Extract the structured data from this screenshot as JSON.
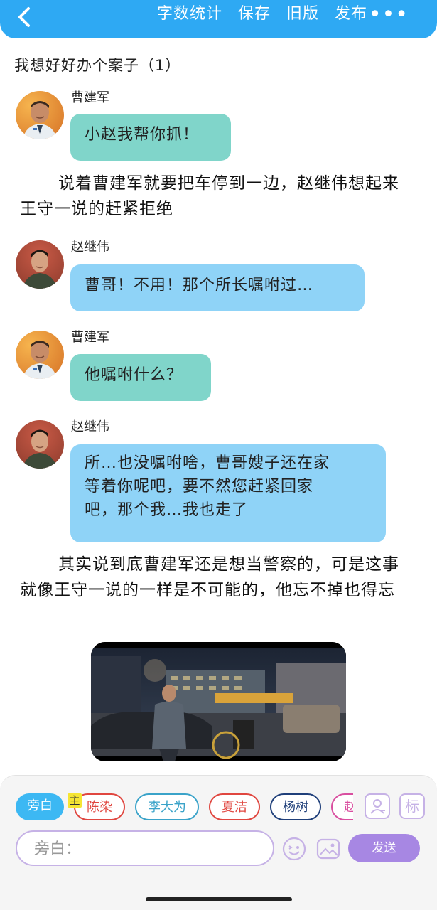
{
  "header": {
    "back_icon": "chevron-left-icon",
    "actions": [
      "字数统计",
      "保存",
      "旧版",
      "发布"
    ],
    "more": "•••"
  },
  "title": "我想好好办个案子（1）",
  "messages": [
    {
      "speaker": "曹建军",
      "text": "小赵我帮你抓！",
      "color": "green"
    },
    {
      "narration": "说着曹建军就要把车停到一边，赵继伟想起来王守一说的赶紧拒绝"
    },
    {
      "speaker": "赵继伟",
      "text": "曹哥！不用！那个所长嘱咐过…",
      "color": "blue"
    },
    {
      "speaker": "曹建军",
      "text": "他嘱咐什么？",
      "color": "green"
    },
    {
      "speaker": "赵继伟",
      "lines": [
        "所…也没嘱咐啥，曹哥嫂子还在家",
        "等着你呢吧，要不然您赶紧回家",
        "吧，那个我…我也走了"
      ],
      "color": "blue"
    },
    {
      "narration": "其实说到底曹建军还是想当警察的，可是这事就像王守一说的一样是不可能的，他忘不掉也得忘"
    }
  ],
  "roles": {
    "narrator": "旁白",
    "main_tag": "主",
    "chips": [
      {
        "label": "陈染",
        "color": "#e0463f"
      },
      {
        "label": "李大为",
        "color": "#3aa3c9"
      },
      {
        "label": "夏洁",
        "color": "#e0463f"
      },
      {
        "label": "杨树",
        "color": "#1f3f7a"
      },
      {
        "label": "赵",
        "color": "#d94fa0"
      }
    ],
    "side_icons": [
      "contact-icon",
      "标"
    ]
  },
  "composer": {
    "placeholder": "旁白：",
    "send": "发送",
    "icons": [
      "emoji-icon",
      "image-icon"
    ]
  },
  "colors": {
    "accent": "#2ea9f3",
    "bubble_green": "#80d5ca",
    "bubble_blue": "#8fd3f7",
    "send": "#a787e3"
  }
}
